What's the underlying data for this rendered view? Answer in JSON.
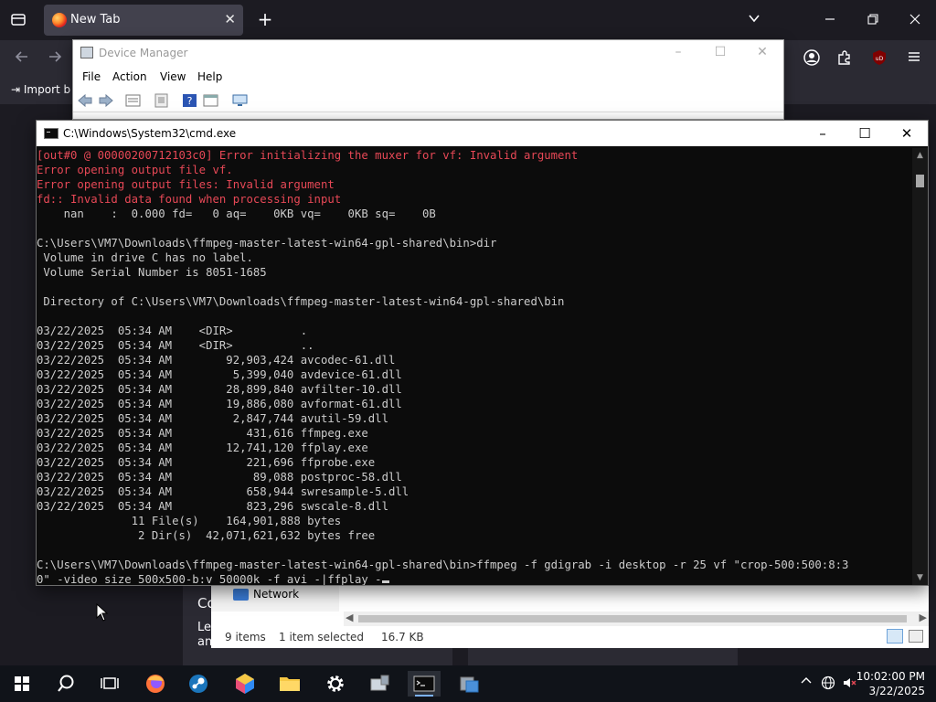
{
  "browser": {
    "tab_title": "New Tab",
    "tab_close": "✕",
    "new_tab": "+",
    "bookmarks_import": "Import b",
    "bg_text_1": "Co",
    "bg_text_2": "Lea",
    "bg_text_3": "an"
  },
  "device_manager": {
    "title": "Device Manager",
    "menu": [
      "File",
      "Action",
      "View",
      "Help"
    ]
  },
  "explorer": {
    "nav_network": "Network",
    "status_items": "9 items",
    "status_selected": "1 item selected",
    "status_size": "16.7 KB"
  },
  "cmd": {
    "title": "C:\\Windows\\System32\\cmd.exe",
    "lines": [
      {
        "text": "[out#0 @ 000002007121​03c0] Error initializing the muxer for vf: Invalid argument",
        "style": "err"
      },
      {
        "text": "Error opening output file vf.",
        "style": "err"
      },
      {
        "text": "Error opening output files: Invalid argument",
        "style": "err"
      },
      {
        "text": "fd:: Invalid data found when processing input",
        "style": "err"
      },
      {
        "text": "    nan    :  0.000 fd=   0 aq=    0KB vq=    0KB sq=    0B",
        "style": ""
      },
      {
        "text": "",
        "style": ""
      },
      {
        "text": "C:\\Users\\VM7\\Downloads\\ffmpeg-master-latest-win64-gpl-shared\\bin>dir",
        "style": ""
      },
      {
        "text": " Volume in drive C has no label.",
        "style": ""
      },
      {
        "text": " Volume Serial Number is 8051-1685",
        "style": ""
      },
      {
        "text": "",
        "style": ""
      },
      {
        "text": " Directory of C:\\Users\\VM7\\Downloads\\ffmpeg-master-latest-win64-gpl-shared\\bin",
        "style": ""
      },
      {
        "text": "",
        "style": ""
      },
      {
        "text": "03/22/2025  05:34 AM    <DIR>          .",
        "style": ""
      },
      {
        "text": "03/22/2025  05:34 AM    <DIR>          ..",
        "style": ""
      },
      {
        "text": "03/22/2025  05:34 AM        92,903,424 avcodec-61.dll",
        "style": ""
      },
      {
        "text": "03/22/2025  05:34 AM         5,399,040 avdevice-61.dll",
        "style": ""
      },
      {
        "text": "03/22/2025  05:34 AM        28,899,840 avfilter-10.dll",
        "style": ""
      },
      {
        "text": "03/22/2025  05:34 AM        19,886,080 avformat-61.dll",
        "style": ""
      },
      {
        "text": "03/22/2025  05:34 AM         2,847,744 avutil-59.dll",
        "style": ""
      },
      {
        "text": "03/22/2025  05:34 AM           431,616 ffmpeg.exe",
        "style": ""
      },
      {
        "text": "03/22/2025  05:34 AM        12,741,120 ffplay.exe",
        "style": ""
      },
      {
        "text": "03/22/2025  05:34 AM           221,696 ffprobe.exe",
        "style": ""
      },
      {
        "text": "03/22/2025  05:34 AM            89,088 postproc-58.dll",
        "style": ""
      },
      {
        "text": "03/22/2025  05:34 AM           658,944 swresample-5.dll",
        "style": ""
      },
      {
        "text": "03/22/2025  05:34 AM           823,296 swscale-8.dll",
        "style": ""
      },
      {
        "text": "              11 File(s)    164,901,888 bytes",
        "style": ""
      },
      {
        "text": "               2 Dir(s)  42,071,621,632 bytes free",
        "style": ""
      },
      {
        "text": "",
        "style": ""
      },
      {
        "text": "C:\\Users\\VM7\\Downloads\\ffmpeg-master-latest-win64-gpl-shared\\bin>ffmpeg -f gdigrab -i desktop -r 25 vf \"crop-500:500:8:3",
        "style": ""
      },
      {
        "text": "0\" -video_size 500x500-b:v 50000k -f avi -|ffplay -",
        "style": "",
        "cursor": true
      }
    ]
  },
  "taskbar": {
    "time": "10:02:00 PM",
    "date": "3/22/2025"
  },
  "colors": {
    "console_bg": "#0c0c0c",
    "console_fg": "#cccccc",
    "console_error": "#e74856",
    "firefox_dark": "#1c1b22",
    "taskbar": "#101319"
  }
}
